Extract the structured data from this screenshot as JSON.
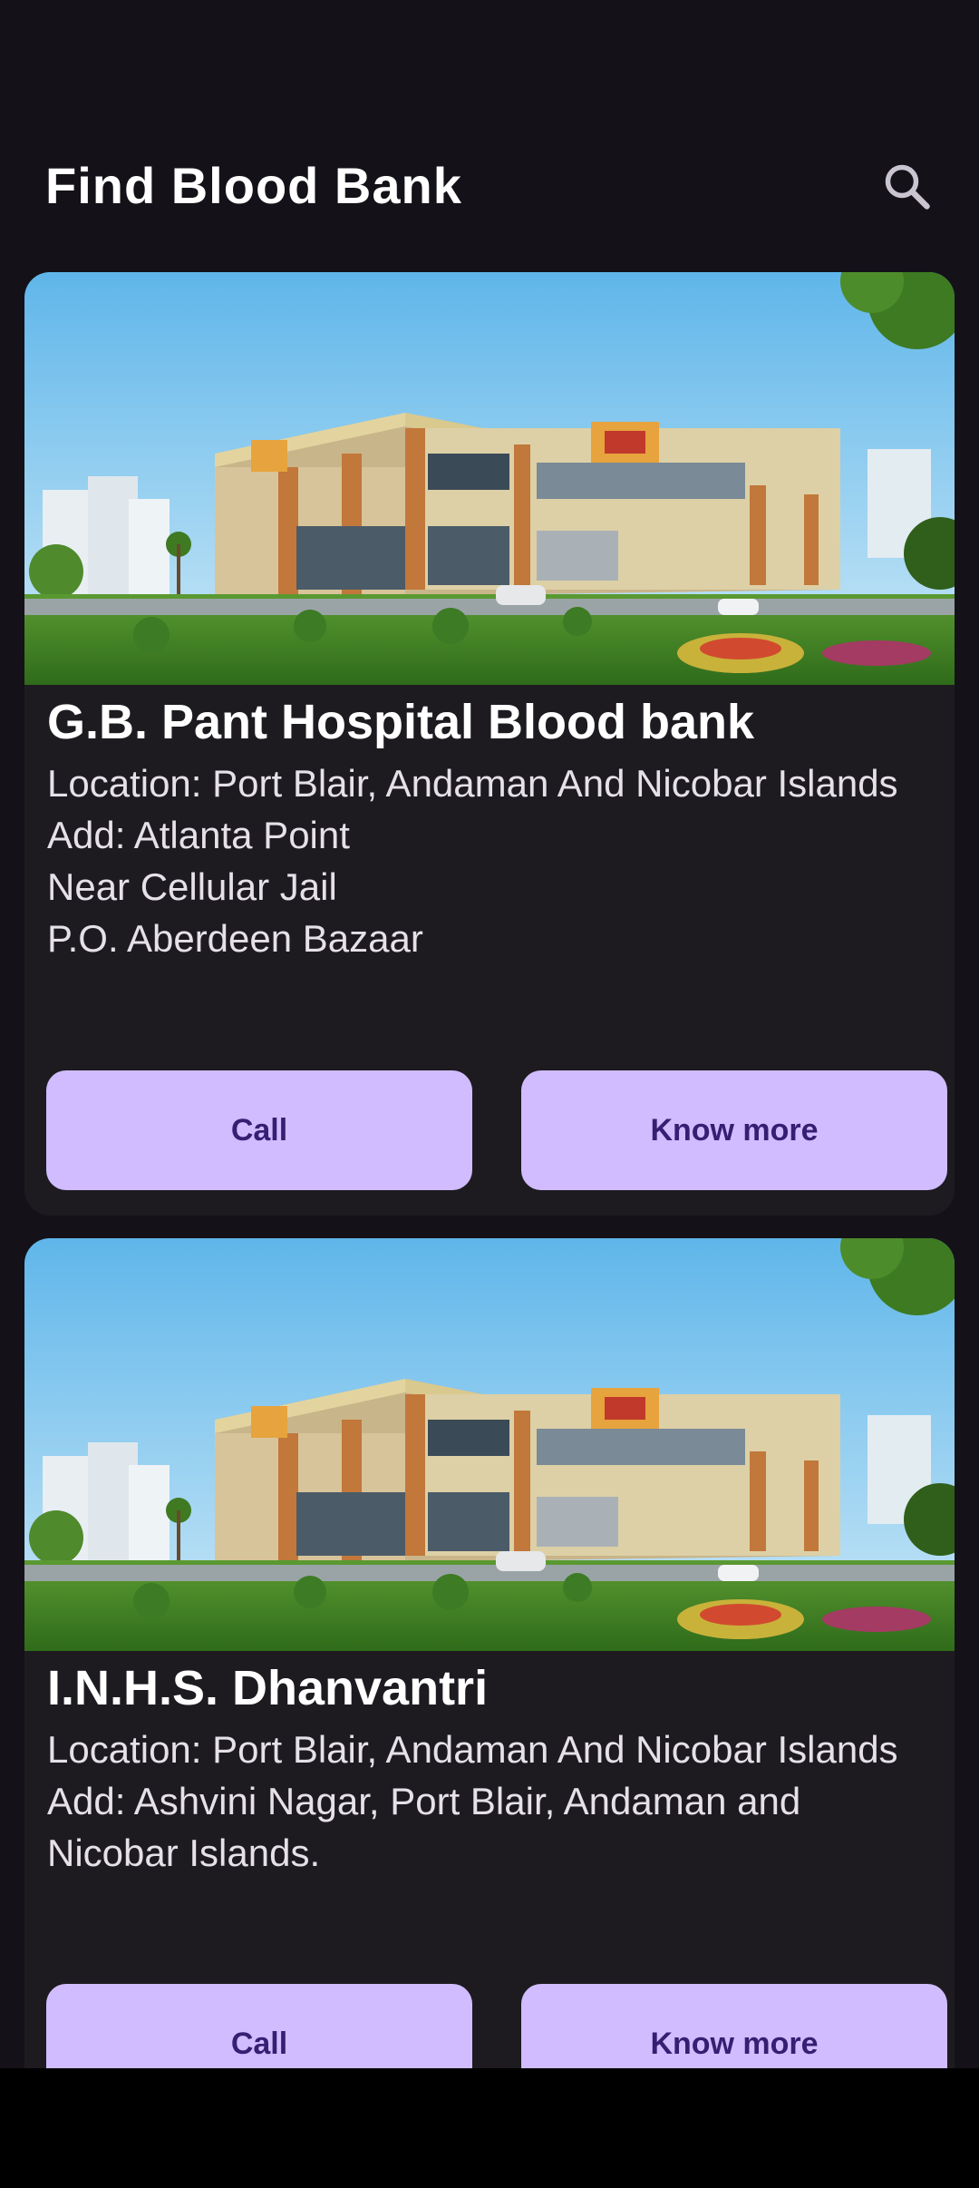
{
  "header": {
    "title": "Find Blood Bank",
    "search_icon": "search-icon"
  },
  "colors": {
    "background": "#141218",
    "card": "#1d1b20",
    "button": "#d0bcff",
    "button_text": "#381e72",
    "title_text": "#ffffff",
    "body_text": "#e6e0e9"
  },
  "banks": [
    {
      "name": "G.B. Pant Hospital Blood bank",
      "location": "Location: Port Blair, Andaman And Nicobar Islands",
      "address_lines": [
        "Add: Atlanta Point",
        "Near Cellular Jail",
        "P.O. Aberdeen Bazaar"
      ],
      "call_label": "Call",
      "more_label": "Know more"
    },
    {
      "name": "I.N.H.S. Dhanvantri",
      "location": "Location: Port Blair, Andaman And Nicobar Islands",
      "address_lines": [
        "Add: Ashvini Nagar, Port Blair, Andaman and Nicobar Islands."
      ],
      "call_label": "Call",
      "more_label": "Know more"
    }
  ]
}
